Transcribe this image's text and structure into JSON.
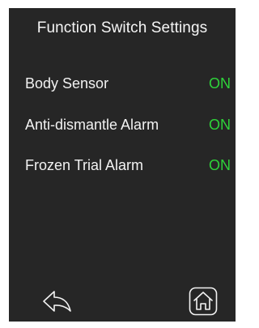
{
  "header": {
    "title": "Function Switch Settings"
  },
  "settings": [
    {
      "label": "Body Sensor",
      "value": "ON"
    },
    {
      "label": "Anti-dismantle Alarm",
      "value": "ON"
    },
    {
      "label": "Frozen Trial Alarm",
      "value": "ON"
    }
  ],
  "footer": {
    "back_icon": "back-arrow-icon",
    "home_icon": "home-icon"
  },
  "colors": {
    "background": "#262626",
    "text": "#f2f2f2",
    "on_status": "#2ed33a"
  }
}
